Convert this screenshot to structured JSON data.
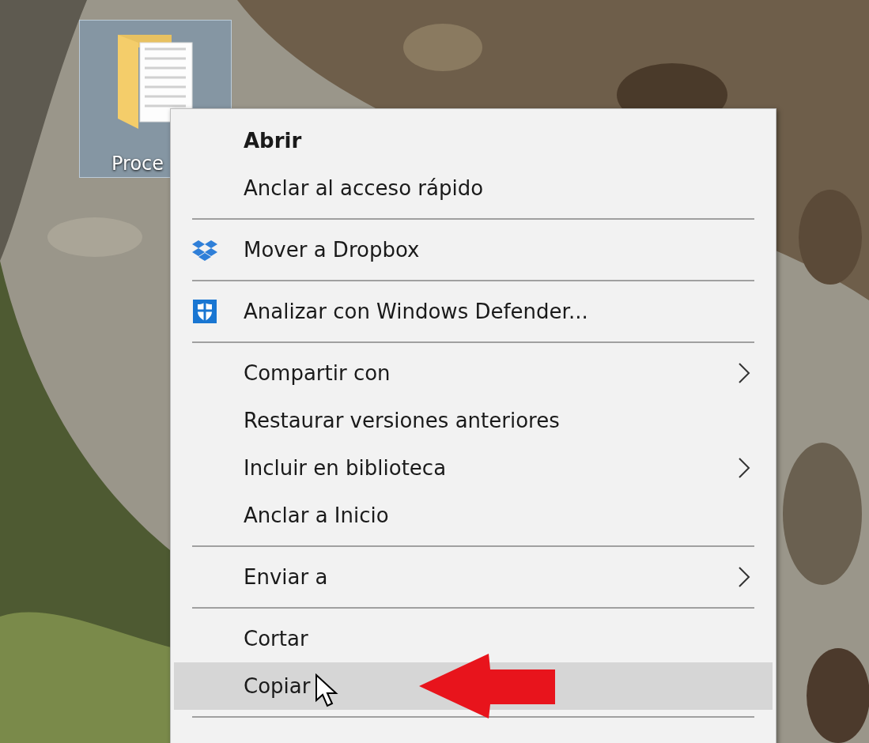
{
  "desktop": {
    "icons": [
      {
        "label": "Proce",
        "selected": true
      }
    ]
  },
  "context_menu": {
    "items": [
      {
        "kind": "item",
        "label": "Abrir",
        "bold": true,
        "submenu": false,
        "selected": false
      },
      {
        "kind": "item",
        "label": "Anclar al acceso rápido",
        "bold": false,
        "submenu": false,
        "selected": false
      },
      {
        "kind": "separator"
      },
      {
        "kind": "dropbox",
        "label": "Mover a Dropbox",
        "bold": false,
        "submenu": false,
        "selected": false
      },
      {
        "kind": "separator"
      },
      {
        "kind": "defender",
        "label": "Analizar con Windows Defender...",
        "bold": false,
        "submenu": false,
        "selected": false
      },
      {
        "kind": "separator"
      },
      {
        "kind": "item",
        "label": "Compartir con",
        "bold": false,
        "submenu": true,
        "selected": false
      },
      {
        "kind": "item",
        "label": "Restaurar versiones anteriores",
        "bold": false,
        "submenu": false,
        "selected": false
      },
      {
        "kind": "item",
        "label": "Incluir en biblioteca",
        "bold": false,
        "submenu": true,
        "selected": false
      },
      {
        "kind": "item",
        "label": "Anclar a Inicio",
        "bold": false,
        "submenu": false,
        "selected": false
      },
      {
        "kind": "separator"
      },
      {
        "kind": "item",
        "label": "Enviar a",
        "bold": false,
        "submenu": true,
        "selected": false
      },
      {
        "kind": "separator"
      },
      {
        "kind": "item",
        "label": "Cortar",
        "bold": false,
        "submenu": false,
        "selected": false
      },
      {
        "kind": "item",
        "label": "Copiar",
        "bold": false,
        "submenu": false,
        "selected": true
      },
      {
        "kind": "separator"
      }
    ]
  }
}
